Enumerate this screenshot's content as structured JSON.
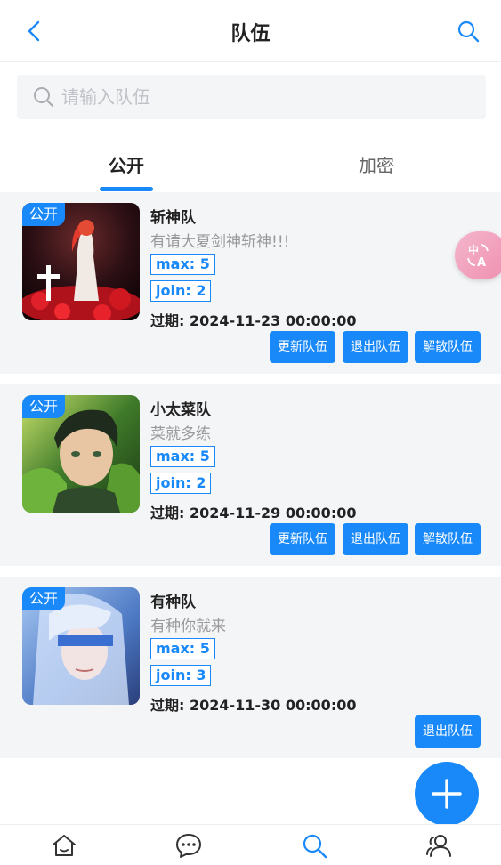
{
  "header": {
    "title": "队伍"
  },
  "search": {
    "placeholder": "请输入队伍"
  },
  "tabs": [
    {
      "label": "公开",
      "active": true
    },
    {
      "label": "加密",
      "active": false
    }
  ],
  "teams": [
    {
      "tag": "公开",
      "name": "斩神队",
      "description": "有请大夏剑神斩神!!!",
      "max": "max: 5",
      "join": "join: 2",
      "expire": "过期: 2024-11-23 00:00:00",
      "actions": [
        "更新队伍",
        "退出队伍",
        "解散队伍"
      ]
    },
    {
      "tag": "公开",
      "name": "小太菜队",
      "description": "菜就多练",
      "max": "max: 5",
      "join": "join: 2",
      "expire": "过期: 2024-11-29 00:00:00",
      "actions": [
        "更新队伍",
        "退出队伍",
        "解散队伍"
      ]
    },
    {
      "tag": "公开",
      "name": "有种队",
      "description": "有种你就来",
      "max": "max: 5",
      "join": "join: 3",
      "expire": "过期: 2024-11-30 00:00:00",
      "actions": [
        "退出队伍"
      ]
    }
  ],
  "translate_fab": {
    "icon": "translate-icon"
  },
  "add_fab": {
    "icon": "plus-icon"
  },
  "tabbar": [
    {
      "icon": "home-icon",
      "active": false
    },
    {
      "icon": "chat-icon",
      "active": false
    },
    {
      "icon": "search-icon",
      "active": true
    },
    {
      "icon": "user-group-icon",
      "active": false
    }
  ],
  "colors": {
    "accent": "#1989fa",
    "card_bg": "#f4f5f7",
    "muted": "#999999"
  }
}
